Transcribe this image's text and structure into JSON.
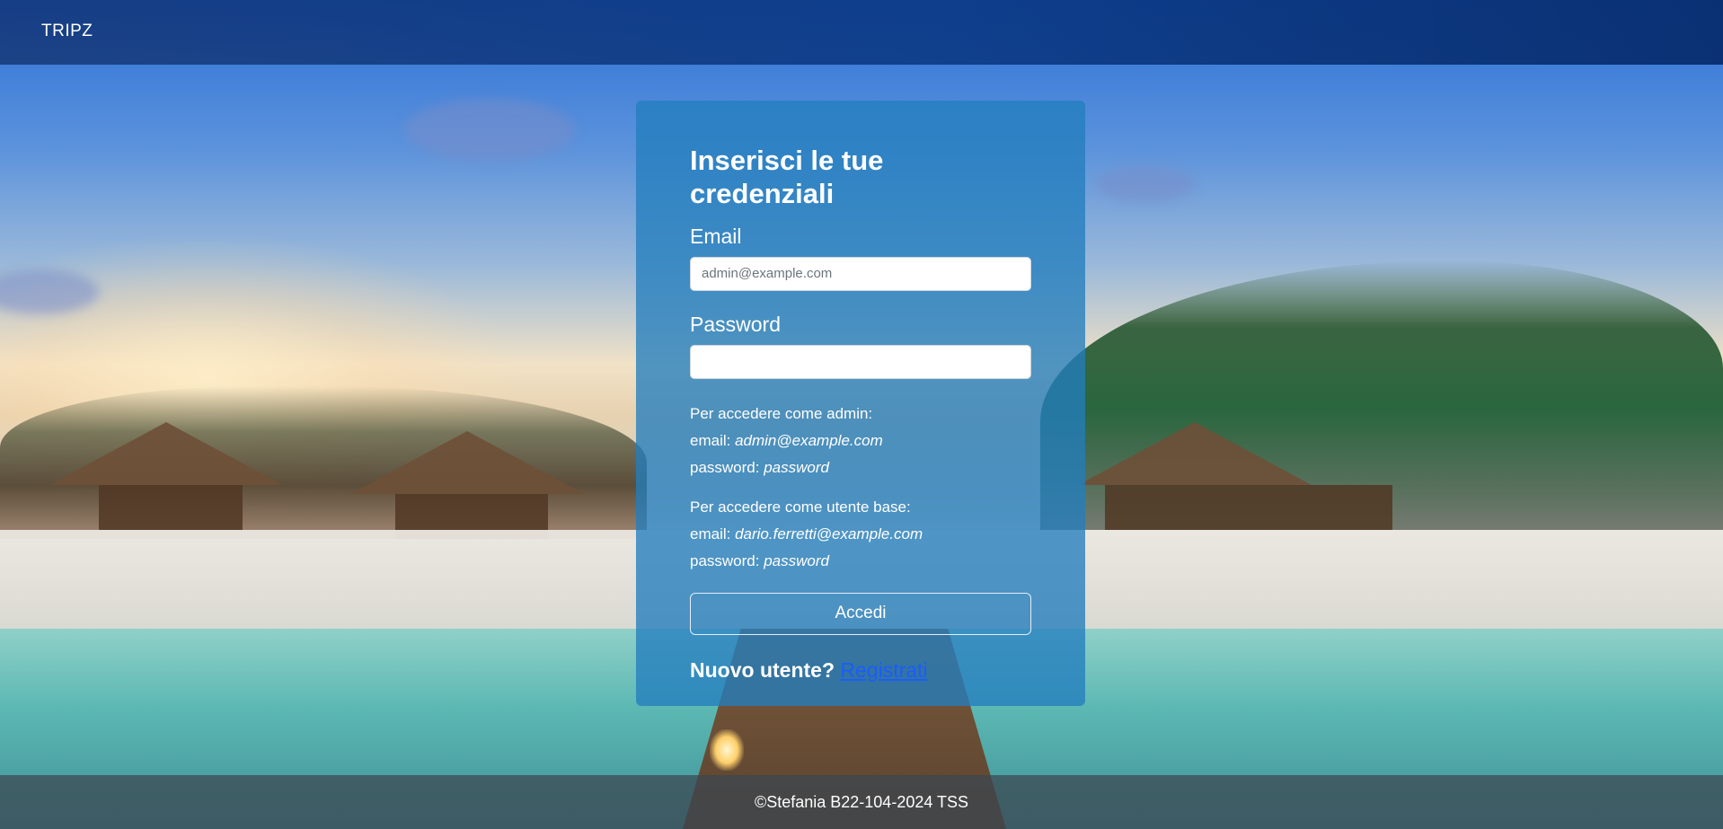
{
  "navbar": {
    "brand": "TRIPZ"
  },
  "login": {
    "title": "Inserisci le tue credenziali",
    "email_label": "Email",
    "email_placeholder": "admin@example.com",
    "email_value": "",
    "password_label": "Password",
    "password_value": "",
    "admin_hint": {
      "intro": "Per accedere come admin:",
      "email_label": "email: ",
      "email_value": "admin@example.com",
      "password_label": "password: ",
      "password_value": "password"
    },
    "user_hint": {
      "intro": "Per accedere come utente base:",
      "email_label": "email: ",
      "email_value": "dario.ferretti@example.com",
      "password_label": "password: ",
      "password_value": "password"
    },
    "submit_label": "Accedi",
    "register_prompt": "Nuovo utente?",
    "register_link": "Registrati"
  },
  "footer": {
    "text": "©Stefania B22-104-2024 TSS"
  },
  "colors": {
    "card_bg": "#237dbe",
    "link": "#1a5cff",
    "navbar": "#0a3782"
  }
}
